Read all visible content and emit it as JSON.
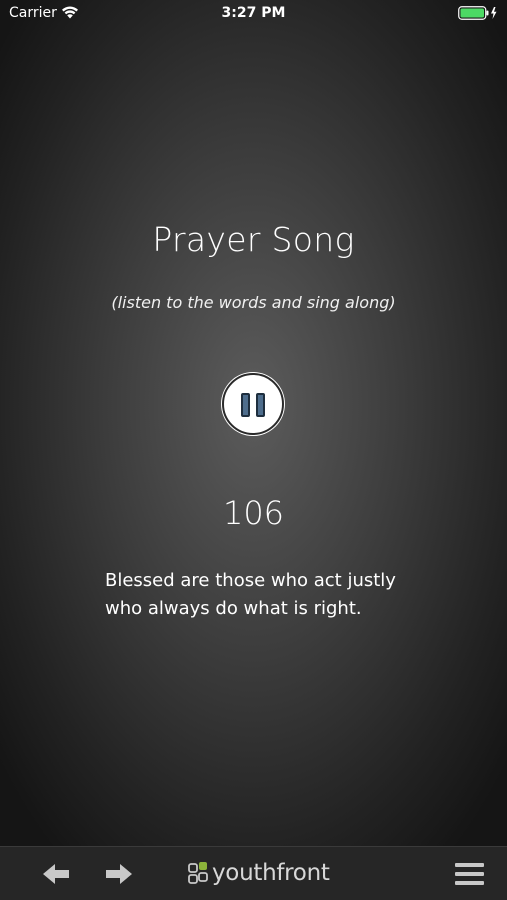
{
  "status_bar": {
    "carrier": "Carrier",
    "time": "3:27 PM",
    "battery_color": "#4cd964"
  },
  "song": {
    "title": "Prayer Song",
    "instruction": "(listen to the words and sing along)",
    "playback_state": "playing",
    "pause_icon": "pause-icon",
    "counter": "106",
    "lyrics": [
      "Blessed are those who act justly",
      "who always do what is right."
    ]
  },
  "toolbar": {
    "back_icon": "arrow-left-icon",
    "forward_icon": "arrow-right-icon",
    "logo_text": "youthfront",
    "menu_icon": "hamburger-menu-icon"
  },
  "colors": {
    "pause_accent": "#4e6d8c",
    "logo_green": "#8cb33a",
    "toolbar_bg": "#262626"
  }
}
